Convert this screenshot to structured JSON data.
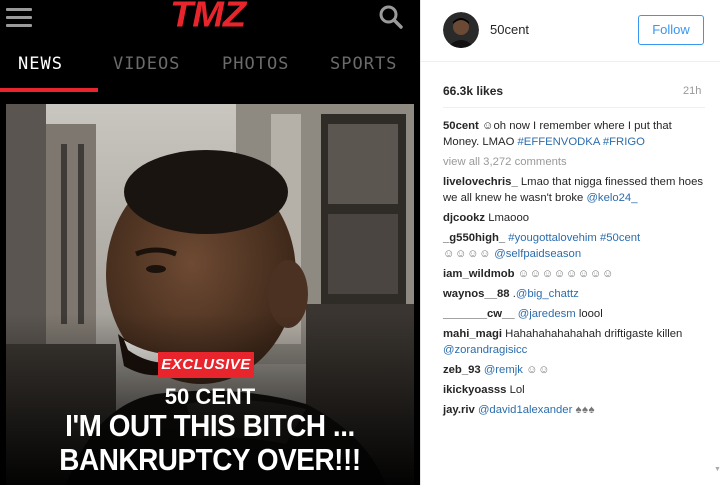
{
  "tmz": {
    "logo": "TMZ",
    "nav": {
      "tabs": [
        {
          "label": "NEWS",
          "active": true
        },
        {
          "label": "VIDEOS",
          "active": false
        },
        {
          "label": "PHOTOS",
          "active": false
        },
        {
          "label": "SPORTS",
          "active": false
        }
      ]
    },
    "article": {
      "badge": "EXCLUSIVE",
      "headline_1": "50 CENT",
      "headline_2": "I'M OUT THIS BITCH ...",
      "headline_3": "BANKRUPTCY OVER!!!"
    },
    "colors": {
      "brand_red": "#e8242c",
      "inactive_tab": "#6b6b6b"
    }
  },
  "instagram": {
    "username": "50cent",
    "follow_label": "Follow",
    "likes": "66.3k likes",
    "time_ago": "21h",
    "caption": {
      "user": "50cent",
      "emoji": "☺",
      "text": "oh now I remember where I put that Money. LMAO ",
      "tags": "#EFFENVODKA #FRIGO"
    },
    "view_all": "view all 3,272 comments",
    "comments": [
      {
        "user": "livelovechris_",
        "text": " Lmao that nigga finessed them hoes we all knew he wasn't broke ",
        "tag": "@kelo24_"
      },
      {
        "user": "djcookz",
        "text": " Lmaooo",
        "tag": ""
      },
      {
        "user": "_g550high_",
        "text": " ",
        "tag": "#yougottalovehim #50cent",
        "emoji": "☺☺☺☺",
        "tag2": "@selfpaidseason"
      },
      {
        "user": "iam_wildmob",
        "text": " ",
        "emoji": "☺☺☺☺☺☺☺☺",
        "tag": ""
      },
      {
        "user": "waynos__88",
        "text": " .",
        "tag": "@big_chattz"
      },
      {
        "user": "_______cw__",
        "text": " ",
        "tag": "@jaredesm",
        "text2": " loool"
      },
      {
        "user": "mahi_magi",
        "text": " Hahahahahahahah driftigaste killen ",
        "tag": "@zorandragisicc"
      },
      {
        "user": "zeb_93",
        "text": " ",
        "tag": "@remjk",
        "emoji": "☺☺"
      },
      {
        "user": "ikickyoasss",
        "text": " Lol",
        "tag": ""
      },
      {
        "user": "jay.riv",
        "text": " ",
        "tag": "@david1alexander",
        "emoji": "♠♠♠"
      }
    ],
    "colors": {
      "link_blue": "#2b6dad",
      "follow_blue": "#3897f0"
    }
  }
}
